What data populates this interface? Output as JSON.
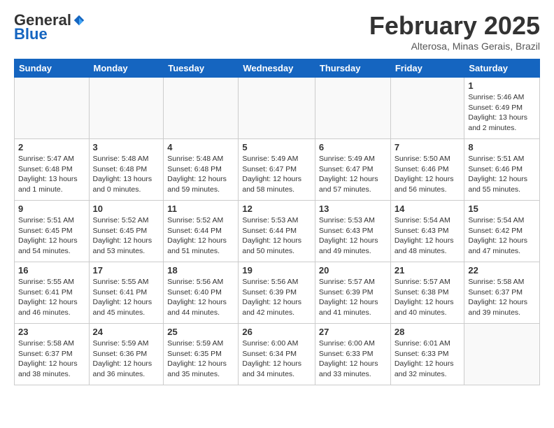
{
  "header": {
    "logo_general": "General",
    "logo_blue": "Blue",
    "month_year": "February 2025",
    "location": "Alterosa, Minas Gerais, Brazil"
  },
  "weekdays": [
    "Sunday",
    "Monday",
    "Tuesday",
    "Wednesday",
    "Thursday",
    "Friday",
    "Saturday"
  ],
  "weeks": [
    [
      {
        "day": "",
        "detail": ""
      },
      {
        "day": "",
        "detail": ""
      },
      {
        "day": "",
        "detail": ""
      },
      {
        "day": "",
        "detail": ""
      },
      {
        "day": "",
        "detail": ""
      },
      {
        "day": "",
        "detail": ""
      },
      {
        "day": "1",
        "detail": "Sunrise: 5:46 AM\nSunset: 6:49 PM\nDaylight: 13 hours and 2 minutes."
      }
    ],
    [
      {
        "day": "2",
        "detail": "Sunrise: 5:47 AM\nSunset: 6:48 PM\nDaylight: 13 hours and 1 minute."
      },
      {
        "day": "3",
        "detail": "Sunrise: 5:48 AM\nSunset: 6:48 PM\nDaylight: 13 hours and 0 minutes."
      },
      {
        "day": "4",
        "detail": "Sunrise: 5:48 AM\nSunset: 6:48 PM\nDaylight: 12 hours and 59 minutes."
      },
      {
        "day": "5",
        "detail": "Sunrise: 5:49 AM\nSunset: 6:47 PM\nDaylight: 12 hours and 58 minutes."
      },
      {
        "day": "6",
        "detail": "Sunrise: 5:49 AM\nSunset: 6:47 PM\nDaylight: 12 hours and 57 minutes."
      },
      {
        "day": "7",
        "detail": "Sunrise: 5:50 AM\nSunset: 6:46 PM\nDaylight: 12 hours and 56 minutes."
      },
      {
        "day": "8",
        "detail": "Sunrise: 5:51 AM\nSunset: 6:46 PM\nDaylight: 12 hours and 55 minutes."
      }
    ],
    [
      {
        "day": "9",
        "detail": "Sunrise: 5:51 AM\nSunset: 6:45 PM\nDaylight: 12 hours and 54 minutes."
      },
      {
        "day": "10",
        "detail": "Sunrise: 5:52 AM\nSunset: 6:45 PM\nDaylight: 12 hours and 53 minutes."
      },
      {
        "day": "11",
        "detail": "Sunrise: 5:52 AM\nSunset: 6:44 PM\nDaylight: 12 hours and 51 minutes."
      },
      {
        "day": "12",
        "detail": "Sunrise: 5:53 AM\nSunset: 6:44 PM\nDaylight: 12 hours and 50 minutes."
      },
      {
        "day": "13",
        "detail": "Sunrise: 5:53 AM\nSunset: 6:43 PM\nDaylight: 12 hours and 49 minutes."
      },
      {
        "day": "14",
        "detail": "Sunrise: 5:54 AM\nSunset: 6:43 PM\nDaylight: 12 hours and 48 minutes."
      },
      {
        "day": "15",
        "detail": "Sunrise: 5:54 AM\nSunset: 6:42 PM\nDaylight: 12 hours and 47 minutes."
      }
    ],
    [
      {
        "day": "16",
        "detail": "Sunrise: 5:55 AM\nSunset: 6:41 PM\nDaylight: 12 hours and 46 minutes."
      },
      {
        "day": "17",
        "detail": "Sunrise: 5:55 AM\nSunset: 6:41 PM\nDaylight: 12 hours and 45 minutes."
      },
      {
        "day": "18",
        "detail": "Sunrise: 5:56 AM\nSunset: 6:40 PM\nDaylight: 12 hours and 44 minutes."
      },
      {
        "day": "19",
        "detail": "Sunrise: 5:56 AM\nSunset: 6:39 PM\nDaylight: 12 hours and 42 minutes."
      },
      {
        "day": "20",
        "detail": "Sunrise: 5:57 AM\nSunset: 6:39 PM\nDaylight: 12 hours and 41 minutes."
      },
      {
        "day": "21",
        "detail": "Sunrise: 5:57 AM\nSunset: 6:38 PM\nDaylight: 12 hours and 40 minutes."
      },
      {
        "day": "22",
        "detail": "Sunrise: 5:58 AM\nSunset: 6:37 PM\nDaylight: 12 hours and 39 minutes."
      }
    ],
    [
      {
        "day": "23",
        "detail": "Sunrise: 5:58 AM\nSunset: 6:37 PM\nDaylight: 12 hours and 38 minutes."
      },
      {
        "day": "24",
        "detail": "Sunrise: 5:59 AM\nSunset: 6:36 PM\nDaylight: 12 hours and 36 minutes."
      },
      {
        "day": "25",
        "detail": "Sunrise: 5:59 AM\nSunset: 6:35 PM\nDaylight: 12 hours and 35 minutes."
      },
      {
        "day": "26",
        "detail": "Sunrise: 6:00 AM\nSunset: 6:34 PM\nDaylight: 12 hours and 34 minutes."
      },
      {
        "day": "27",
        "detail": "Sunrise: 6:00 AM\nSunset: 6:33 PM\nDaylight: 12 hours and 33 minutes."
      },
      {
        "day": "28",
        "detail": "Sunrise: 6:01 AM\nSunset: 6:33 PM\nDaylight: 12 hours and 32 minutes."
      },
      {
        "day": "",
        "detail": ""
      }
    ]
  ]
}
